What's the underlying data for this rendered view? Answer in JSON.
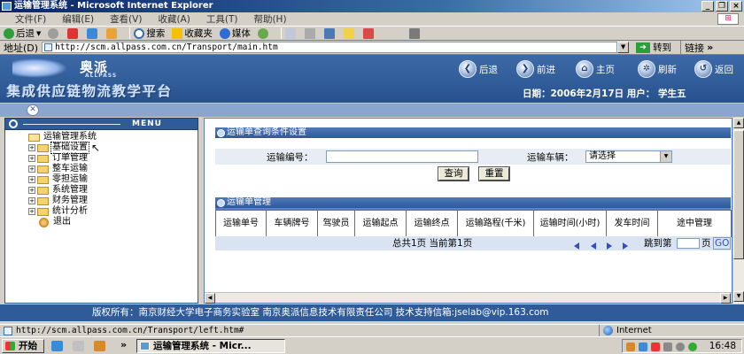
{
  "window": {
    "title": "运输管理系统 - Microsoft Internet Explorer",
    "buttons": [
      "_",
      "❐",
      "×"
    ]
  },
  "menubar": {
    "items": [
      "文件(F)",
      "编辑(E)",
      "查看(V)",
      "收藏(A)",
      "工具(T)",
      "帮助(H)"
    ]
  },
  "toolbar": {
    "back": "后退",
    "search": "搜索",
    "favorites": "收藏夹",
    "media": "媒体"
  },
  "address": {
    "label": "地址(D)",
    "url": "http://scm.allpass.com.cn/Transport/main.htm",
    "go": "转到",
    "links": "链接"
  },
  "header": {
    "brand": "奥派",
    "brand_sub": "ALLPASS",
    "platform": "集成供应链物流教学平台",
    "nav": [
      "后退",
      "前进",
      "主页",
      "刷新",
      "返回"
    ],
    "date_line": "日期：2006年2月17日  用户： 学生五"
  },
  "leftmenu": {
    "header": "MENU",
    "root": "运输管理系统",
    "items": [
      "基础设置",
      "订单管理",
      "整车运输",
      "零担运输",
      "系统管理",
      "财务管理",
      "统计分析"
    ],
    "exit": "退出"
  },
  "query": {
    "title": "运输单查询条件设置",
    "number_label": "运输编号：",
    "number_value": "",
    "vehicle_label": "运输车辆：",
    "vehicle_value": "请选择",
    "search_btn": "查询",
    "reset_btn": "重置"
  },
  "manage": {
    "title": "运输单管理",
    "columns": [
      "运输单号",
      "车辆牌号",
      "驾驶员",
      "运输起点",
      "运输终点",
      "运输路程(千米)",
      "运输时间(小时)",
      "发车时间",
      "途中管理"
    ],
    "pager_text": "总共1页 当前第1页",
    "jump_label": "跳到第",
    "page_suffix": "页",
    "go_label": "GO"
  },
  "footer": {
    "text": "版权所有：南京财经大学电子商务实验室  南京奥派信息技术有限责任公司  技术支持信箱:jselab@vip.163.com"
  },
  "status": {
    "url": "http://scm.allpass.com.cn/Transport/left.htm#",
    "zone": "Internet"
  },
  "taskbar": {
    "start": "开始",
    "active_task": "运输管理系统 - Micr...",
    "time": "16:48"
  }
}
